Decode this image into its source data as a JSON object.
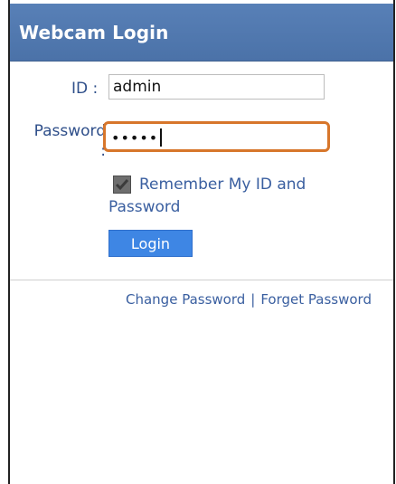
{
  "header": {
    "title": "Webcam Login"
  },
  "form": {
    "id_label": "ID :",
    "id_value": "admin",
    "password_label_line1": "Password",
    "password_label_line2": ":",
    "password_masked": "•••••",
    "remember_label": "Remember My ID and Password",
    "remember_checked": true,
    "login_label": "Login"
  },
  "footer": {
    "change_password": "Change Password",
    "separator": "|",
    "forget_password": "Forget Password"
  },
  "colors": {
    "header_bg": "#4b72a8",
    "link_text": "#3a5fa0",
    "focus_border": "#d7762b",
    "button_bg": "#3e86e4"
  },
  "icons": {
    "checkbox": "checkmark-icon"
  }
}
